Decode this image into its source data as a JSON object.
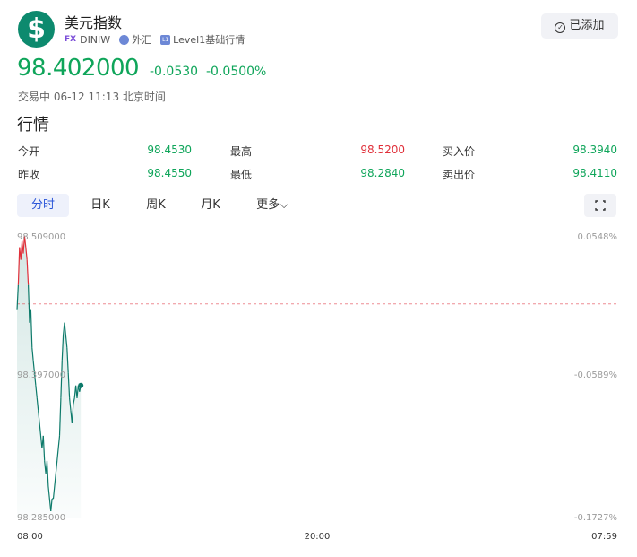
{
  "header": {
    "logo_symbol": "$",
    "title": "美元指数",
    "market_tag": "FX",
    "code": "DINIW",
    "category": "外汇",
    "level_badge": "L1",
    "level_text": "Level1基础行情",
    "added_label": "已添加"
  },
  "quote": {
    "price": "98.402000",
    "change": "-0.0530",
    "change_pct": "-0.0500%",
    "status": "交易中 06-12 11:13 北京时间"
  },
  "section_title": "行情",
  "stats": {
    "open_label": "今开",
    "open_value": "98.4530",
    "high_label": "最高",
    "high_value": "98.5200",
    "bid_label": "买入价",
    "bid_value": "98.3940",
    "prev_close_label": "昨收",
    "prev_close_value": "98.4550",
    "low_label": "最低",
    "low_value": "98.2840",
    "ask_label": "卖出价",
    "ask_value": "98.4110"
  },
  "tabs": [
    "分时",
    "日K",
    "周K",
    "月K",
    "更多"
  ],
  "active_tab": "分时",
  "colors": {
    "up": "#e0303a",
    "down": "#0fa55a",
    "line_green": "#0d7a6a",
    "accent": "#2b56d8"
  },
  "chart_data": {
    "type": "line",
    "title": "",
    "xlabel": "",
    "ylabel": "",
    "x_ticks": [
      "08:00",
      "20:00",
      "07:59"
    ],
    "y_left_ticks": [
      "98.509000",
      "98.397000",
      "98.285000"
    ],
    "y_right_ticks": [
      "0.0548%",
      "-0.0589%",
      "-0.1727%"
    ],
    "ylim": [
      98.285,
      98.509
    ],
    "reference_line": 98.455,
    "session_minutes": 1440,
    "series": [
      {
        "values": [
          98.45,
          98.47,
          98.5,
          98.49,
          98.505,
          98.495,
          98.509,
          98.5,
          98.49,
          98.47,
          98.44,
          98.45,
          98.42,
          98.41,
          98.4,
          98.39,
          98.38,
          98.37,
          98.36,
          98.35,
          98.34,
          98.35,
          98.33,
          98.32,
          98.33,
          98.31,
          98.3,
          98.29,
          98.3,
          98.3,
          98.31,
          98.32,
          98.33,
          98.34,
          98.35,
          98.38,
          98.41,
          98.43,
          98.44,
          98.43,
          98.42,
          98.4,
          98.38,
          98.37,
          98.36,
          98.375,
          98.38,
          98.39,
          98.38,
          98.39,
          98.385,
          98.39
        ]
      }
    ]
  }
}
